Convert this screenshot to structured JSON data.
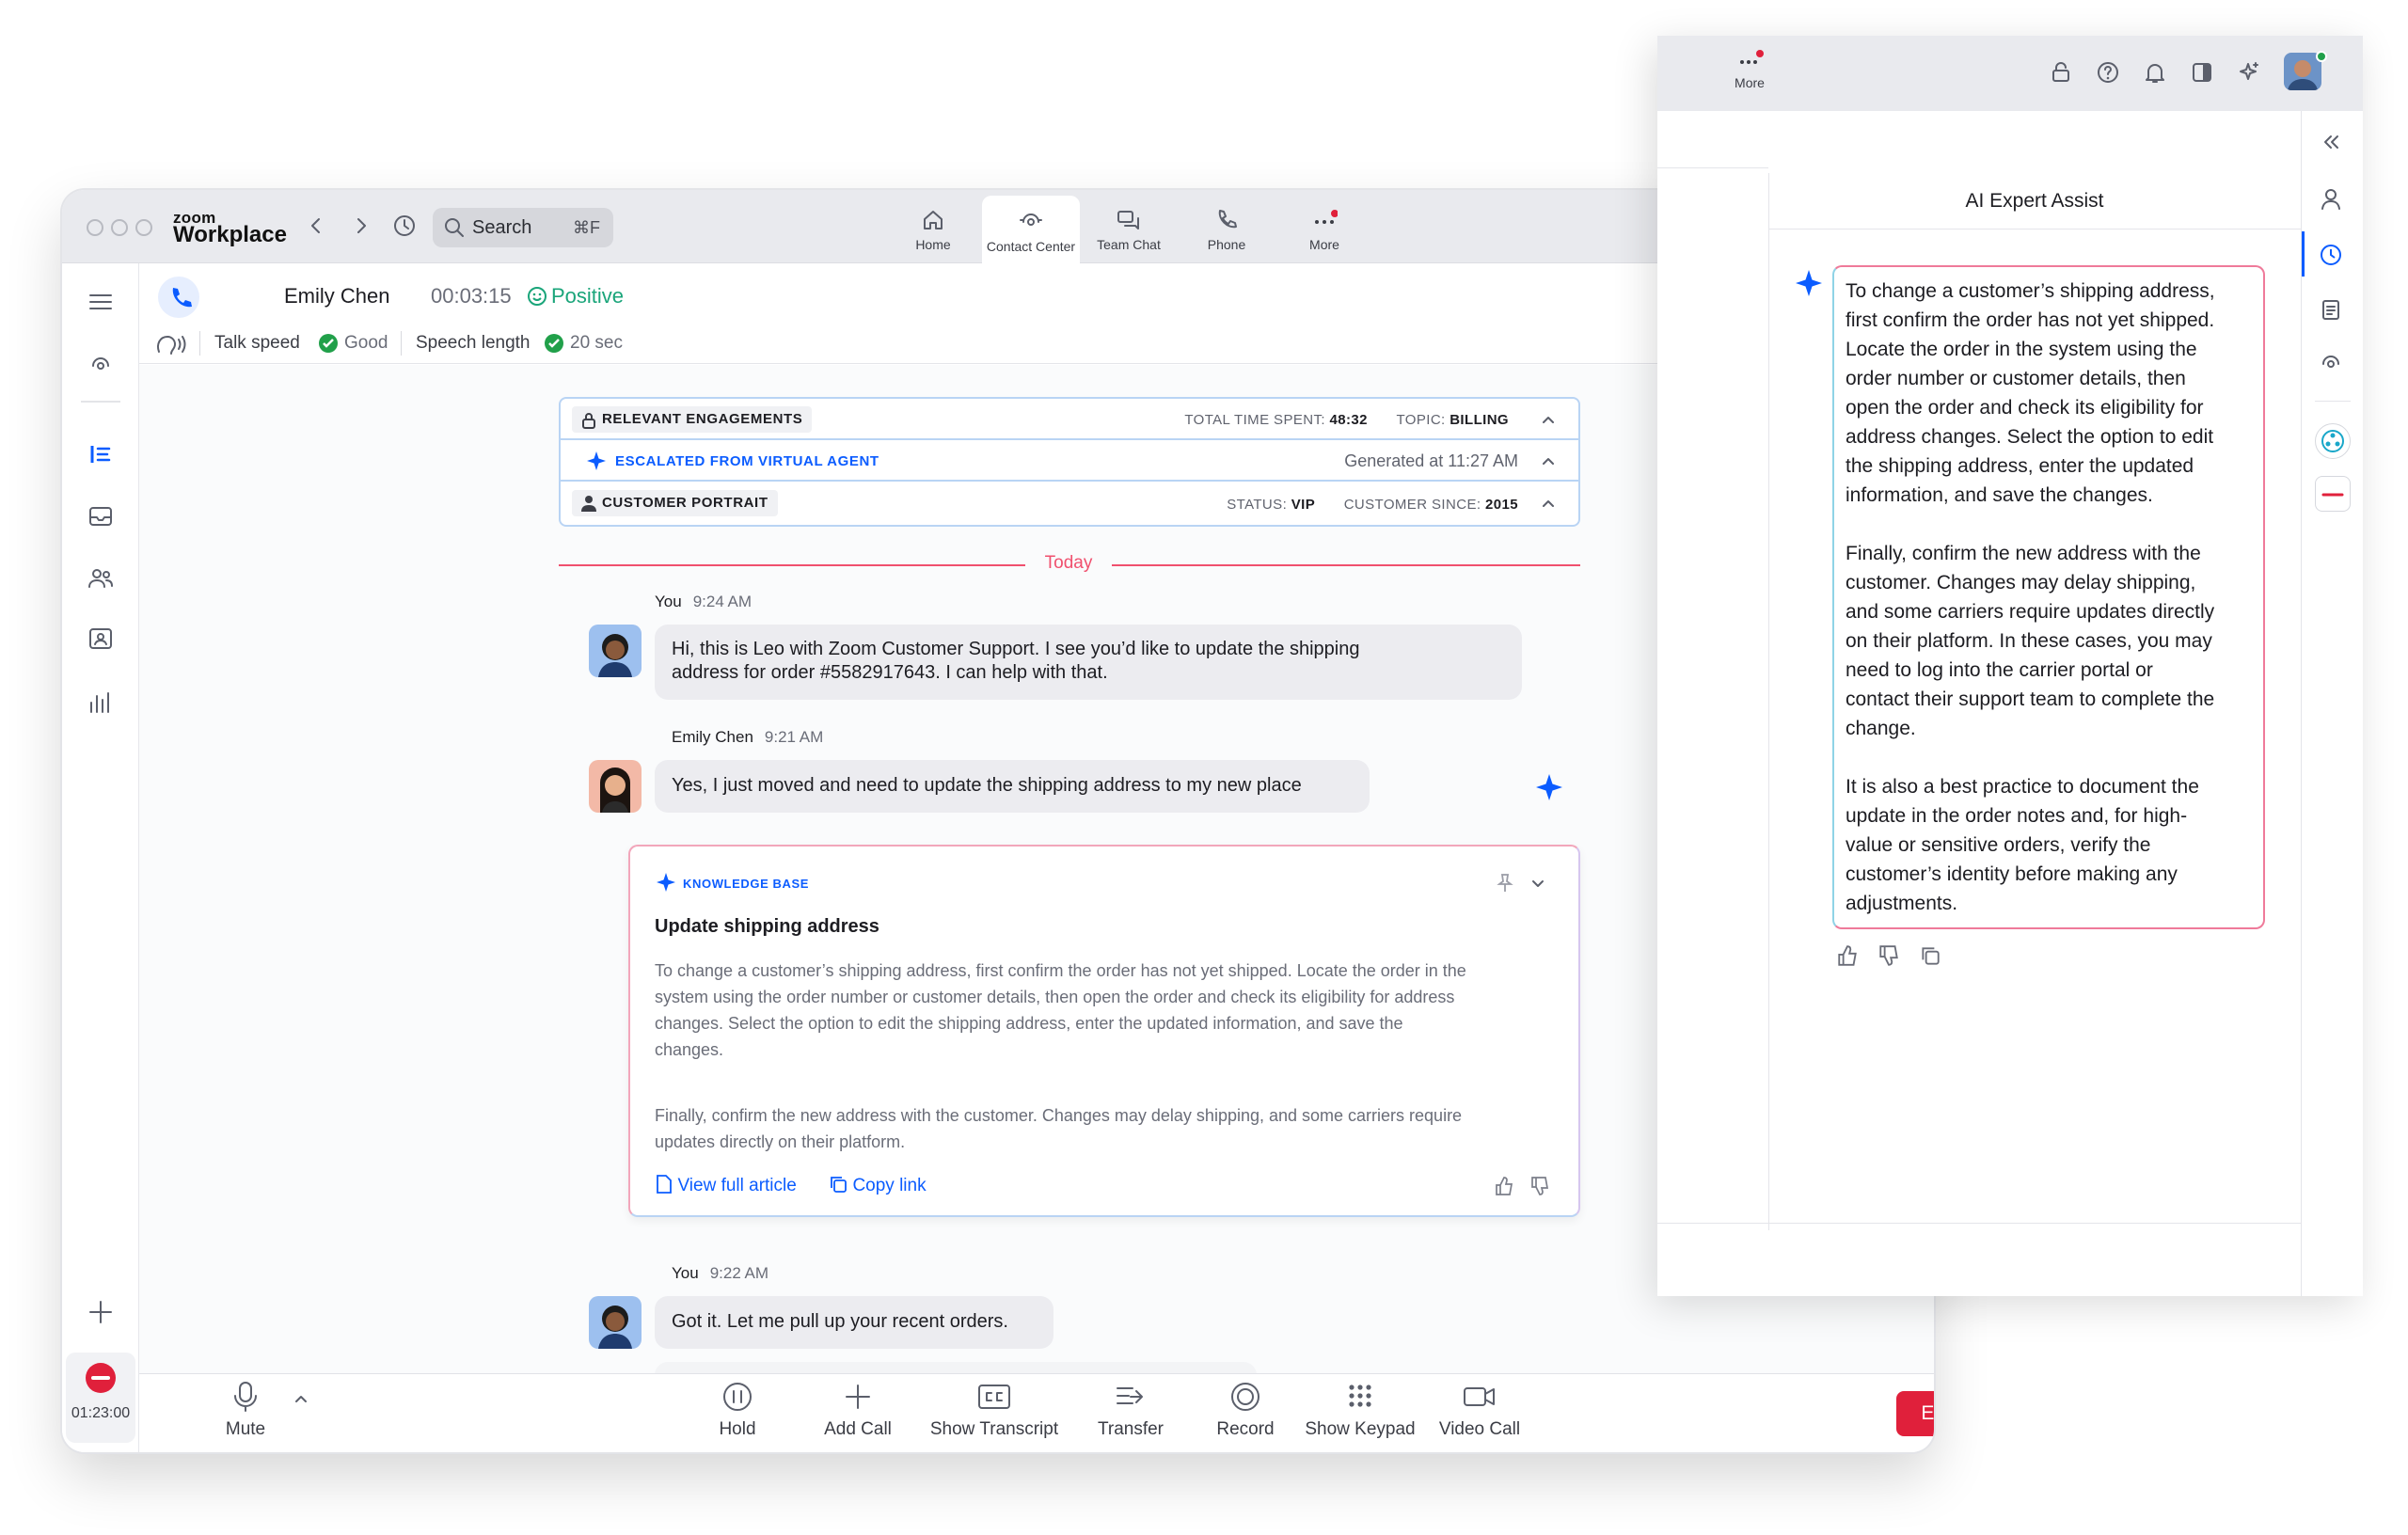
{
  "window": {
    "brand_small": "zoom",
    "brand": "Workplace",
    "search_placeholder": "Search",
    "search_shortcut": "⌘F",
    "nav": [
      {
        "label": "Home"
      },
      {
        "label": "Contact Center"
      },
      {
        "label": "Team Chat"
      },
      {
        "label": "Phone"
      },
      {
        "label": "More"
      }
    ]
  },
  "call": {
    "caller": "Emily Chen",
    "duration": "00:03:15",
    "sentiment": "Positive",
    "talk_speed_label": "Talk speed",
    "talk_speed_value": "Good",
    "speech_length_label": "Speech length",
    "speech_length_value": "20 sec"
  },
  "panels": {
    "engagements": {
      "label": "RELEVANT ENGAGEMENTS",
      "time_label": "TOTAL TIME SPENT:",
      "time_value": "48:32",
      "topic_label": "TOPIC:",
      "topic_value": "BILLING"
    },
    "escalated": {
      "label": "ESCALATED FROM VIRTUAL AGENT",
      "generated": "Generated at 11:27 AM"
    },
    "portrait": {
      "label": "CUSTOMER PORTRAIT",
      "status_label": "STATUS:",
      "status_value": "VIP",
      "since_label": "CUSTOMER SINCE:",
      "since_value": "2015"
    }
  },
  "chat": {
    "divider": "Today",
    "messages": [
      {
        "sender": "You",
        "time": "9:24 AM",
        "text_lines": [
          "Hi, this is Leo with Zoom Customer Support. I see you’d like to update the shipping",
          "address for order #5582917643. I can help with that."
        ]
      },
      {
        "sender": "Emily Chen",
        "time": "9:21 AM",
        "text": "Yes, I just moved and need to update the shipping address to my new place"
      },
      {
        "sender": "You",
        "time": "9:22 AM",
        "text": "Got it. Let me pull up your recent orders."
      }
    ]
  },
  "knowledge": {
    "tag": "KNOWLEDGE BASE",
    "title": "Update shipping address",
    "para1_lines": [
      "To change a customer’s shipping address, first confirm the order has not yet shipped. Locate the order in the",
      "system using the order number or customer details, then open the order and check its eligibility for address",
      "changes. Select the option to edit the shipping address, enter the updated information, and save the",
      "changes."
    ],
    "para2_lines": [
      "Finally, confirm the new address with the customer. Changes may delay shipping, and some carriers require",
      "updates directly on their platform."
    ],
    "view_article": "View full article",
    "copy_link": "Copy link"
  },
  "sidebar": {
    "timer": "01:23:00"
  },
  "toolbar": {
    "mute": "Mute",
    "hold": "Hold",
    "add_call": "Add Call",
    "show_transcript": "Show Transcript",
    "transfer": "Transfer",
    "record": "Record",
    "show_keypad": "Show Keypad",
    "video_call": "Video Call",
    "end": "End"
  },
  "assist": {
    "more_label": "More",
    "title": "AI Expert Assist",
    "answer_lines": [
      "To change a customer’s shipping address,",
      "first confirm the order has not yet shipped.",
      "Locate the order in the system using the",
      "order number or customer details, then",
      "open the order and check its eligibility for",
      "address changes. Select the option to edit",
      "the shipping address, enter the updated",
      "information, and save the changes.",
      "",
      "Finally, confirm the new address with the",
      "customer. Changes may delay shipping,",
      "and some carriers require updates directly",
      "on their platform. In these cases, you may",
      "need to log into the carrier portal or",
      "contact their support team to complete the",
      "change.",
      "",
      "It is also a best practice to document the",
      "update in the order notes and, for high-",
      "value or sensitive orders, verify the",
      "customer’s identity before making any",
      "adjustments."
    ]
  },
  "colors": {
    "accent": "#0b5cff",
    "danger": "#e0203b",
    "positive": "#1aa57a",
    "ok": "#21a04a",
    "divider": "#f0506e"
  }
}
